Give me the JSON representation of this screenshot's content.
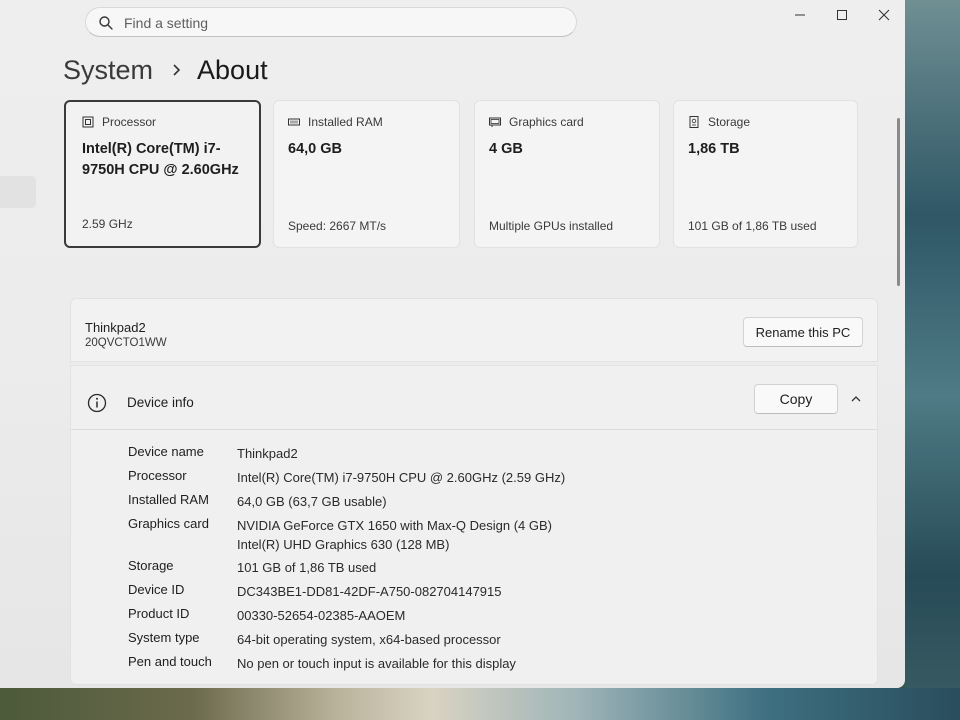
{
  "search": {
    "placeholder": "Find a setting"
  },
  "breadcrumb": {
    "parent": "System",
    "current": "About"
  },
  "cards": [
    {
      "label": "Processor",
      "value": "Intel(R) Core(TM) i7-9750H CPU @ 2.60GHz",
      "sub": "2.59 GHz",
      "icon": "processor-icon"
    },
    {
      "label": "Installed RAM",
      "value": "64,0 GB",
      "sub": "Speed: 2667 MT/s",
      "icon": "ram-icon"
    },
    {
      "label": "Graphics card",
      "value": "4 GB",
      "sub": "Multiple GPUs installed",
      "icon": "graphics-card-icon"
    },
    {
      "label": "Storage",
      "value": "1,86 TB",
      "sub": "101 GB of 1,86 TB used",
      "icon": "storage-icon"
    }
  ],
  "pc": {
    "name": "Thinkpad2",
    "model": "20QVCTO1WW",
    "rename_label": "Rename this PC"
  },
  "device_info": {
    "title": "Device info",
    "copy_label": "Copy",
    "rows": [
      {
        "label": "Device name",
        "value": "Thinkpad2"
      },
      {
        "label": "Processor",
        "value": "Intel(R) Core(TM) i7-9750H CPU @ 2.60GHz (2.59 GHz)"
      },
      {
        "label": "Installed RAM",
        "value": "64,0 GB (63,7 GB usable)"
      },
      {
        "label": "Graphics card",
        "value": "NVIDIA GeForce GTX 1650 with Max-Q Design (4 GB)",
        "value2": "Intel(R) UHD Graphics 630 (128 MB)"
      },
      {
        "label": "Storage",
        "value": "101 GB of 1,86 TB used"
      },
      {
        "label": "Device ID",
        "value": "DC343BE1-DD81-42DF-A750-082704147915"
      },
      {
        "label": "Product ID",
        "value": "00330-52654-02385-AAOEM"
      },
      {
        "label": "System type",
        "value": "64-bit operating system, x64-based processor"
      },
      {
        "label": "Pen and touch",
        "value": "No pen or touch input is available for this display"
      }
    ]
  }
}
